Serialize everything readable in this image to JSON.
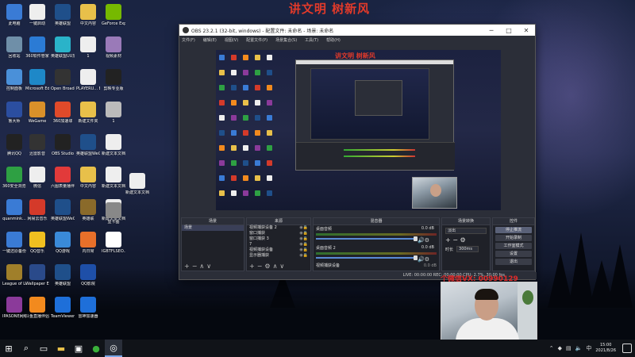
{
  "banner": "讲文明 树新风",
  "desktop": {
    "col1": [
      {
        "label": "此电脑",
        "icon": "pc-icon",
        "color": "#3a7bd5"
      },
      {
        "label": "回收站",
        "icon": "recycle-bin-icon",
        "color": "#6f8fa8"
      },
      {
        "label": "控制面板",
        "icon": "control-panel-icon",
        "color": "#4a90d9"
      },
      {
        "label": "鲁大师",
        "icon": "ludashi-icon",
        "color": "#2b4ea0"
      },
      {
        "label": "腾讯QQ",
        "icon": "qq-icon",
        "color": "#222"
      },
      {
        "label": "360安全浏览器",
        "icon": "360-browser-icon",
        "color": "#2ea043"
      },
      {
        "label": "quanmink...",
        "icon": "quanmin-icon",
        "color": "#3a7bd5"
      },
      {
        "label": "一键还原备份",
        "icon": "restore-icon",
        "color": "#3a7bd5"
      },
      {
        "label": "League of Legends",
        "icon": "lol-icon",
        "color": "#a07f2a"
      },
      {
        "label": "IPASONE网络软件",
        "icon": "ipasone-icon",
        "color": "#8b3a9a"
      }
    ],
    "col2": [
      {
        "label": "一键启动",
        "icon": "file-icon",
        "color": "#eee"
      },
      {
        "label": "360软件管家",
        "icon": "360-manager-icon",
        "color": "#2b7bd5"
      },
      {
        "label": "Microsoft Edge",
        "icon": "edge-icon",
        "color": "#1e88c8"
      },
      {
        "label": "WeGame",
        "icon": "wegame-icon",
        "color": "#d9902a"
      },
      {
        "label": "迅雷影音",
        "icon": "xunlei-icon",
        "color": "#333"
      },
      {
        "label": "微信",
        "icon": "wechat-file-icon",
        "color": "#eee"
      },
      {
        "label": "网易云音乐",
        "icon": "netease-music-icon",
        "color": "#d43a2a"
      },
      {
        "label": "QQ音乐",
        "icon": "qq-music-icon",
        "color": "#f0c020"
      },
      {
        "label": "Wallpaper Engine",
        "icon": "wallpaper-engine-icon",
        "color": "#2a4a8a"
      },
      {
        "label": "斗鱼直播伴侣",
        "icon": "douyu-icon",
        "color": "#f28a1e"
      }
    ],
    "col3": [
      {
        "label": "英雄联盟",
        "icon": "lol-client-icon",
        "color": "#1f4f8a"
      },
      {
        "label": "英雄联盟UU加速器",
        "icon": "uu-icon",
        "color": "#2ab3c9"
      },
      {
        "label": "Open Broadcast...",
        "icon": "obs-icon",
        "color": "#333"
      },
      {
        "label": "360加速球",
        "icon": "360-ball-icon",
        "color": "#e04a2a"
      },
      {
        "label": "OBS Studio",
        "icon": "obs-studio-icon",
        "color": "#222"
      },
      {
        "label": "六图表量播伴侣",
        "icon": "liutu-icon",
        "color": "#e23a3a"
      },
      {
        "label": "英雄联盟WeGame版",
        "icon": "lol-wegame-icon",
        "color": "#1f4f8a"
      },
      {
        "label": "QQ游戏",
        "icon": "qq-game-icon",
        "color": "#3a8ad9"
      },
      {
        "label": "英雄联盟",
        "icon": "lol-client2-icon",
        "color": "#1f4f8a"
      },
      {
        "label": "TeamViewer",
        "icon": "teamviewer-icon",
        "color": "#1e6fd9"
      }
    ],
    "col4": [
      {
        "label": "中文內容",
        "icon": "folder-icon",
        "color": "#e8c04a"
      },
      {
        "label": "1",
        "icon": "file-icon2",
        "color": "#eee"
      },
      {
        "label": "PLAYERU... BATTLEGR...",
        "icon": "pubg-file-icon",
        "color": "#eee"
      },
      {
        "label": "新建文件夹",
        "icon": "folder-new-icon",
        "color": "#e8c04a"
      },
      {
        "label": "英雄联盟WeGame版",
        "icon": "lol-wegame2-icon",
        "color": "#1f4f8a"
      },
      {
        "label": "中文內容",
        "icon": "folder2-icon",
        "color": "#e8c04a"
      },
      {
        "label": "英雄联",
        "icon": "lol3-icon",
        "color": "#8a6a2a"
      },
      {
        "label": "内日常",
        "icon": "daily-icon",
        "color": "#e8702a"
      },
      {
        "label": "QQ影院",
        "icon": "qq-video-icon",
        "color": "#1e4fa8"
      },
      {
        "label": "雷神加速器",
        "icon": "leishen-icon",
        "color": "#1e6fd9"
      }
    ],
    "col5": [
      {
        "label": "GeForce Experience",
        "icon": "nvidia-icon",
        "color": "#76b900"
      },
      {
        "label": "视频素材",
        "icon": "video-file-icon",
        "color": "#9a7ab8"
      },
      {
        "label": "剪映专业版",
        "icon": "jianying-icon",
        "color": "#222"
      },
      {
        "label": "1",
        "icon": "img-file-icon",
        "color": "#bbb"
      },
      {
        "label": "新建文本文档",
        "icon": "txt-icon",
        "color": "#eee"
      },
      {
        "label": "新建文本文档(2)",
        "icon": "txt2-icon",
        "color": "#eee"
      },
      {
        "label": "新建文本文档(3)",
        "icon": "txt3-icon",
        "color": "#eee"
      },
      {
        "label": "IGBTFLSEO...",
        "icon": "igbt-icon",
        "color": "#fff"
      }
    ],
    "extra": [
      {
        "label": "新建文本文档(2)",
        "icon": "txt4-icon",
        "color": "#eee"
      },
      {
        "label": "显卡图",
        "icon": "gpu-img-icon",
        "color": "#888"
      }
    ]
  },
  "obs": {
    "title": "OBS 23.2.1 (32-bit, windows) - 配置文件: 未命名 - 场景: 未命名",
    "menu": [
      "文件(F)",
      "编辑(E)",
      "视图(V)",
      "配置文件(P)",
      "场景集合(S)",
      "工具(T)",
      "帮助(H)"
    ],
    "preview_banner": "讲文明 树新风",
    "docks": {
      "scenes": {
        "title": "场景",
        "items": [
          "场景"
        ]
      },
      "sources": {
        "title": "来源",
        "items": [
          "视频捕获设备 2",
          "窗口捕获",
          "窗口捕获 3",
          "7",
          "视频捕获设备",
          "显示器捕获"
        ]
      },
      "mixer": {
        "title": "混音器",
        "channels": [
          {
            "name": "桌面音频",
            "db": "0.0 dB"
          },
          {
            "name": "桌面音频 2",
            "db": "0.0 dB"
          }
        ],
        "footer": "视频捕获设备",
        "footer_db": "0.0 dB"
      },
      "transitions": {
        "title": "场景转换",
        "type": "淡出",
        "duration_label": "时长",
        "duration": "300ms"
      },
      "controls": {
        "title": "控件",
        "buttons": [
          "停止推流",
          "开始录制",
          "工作室模式",
          "设置",
          "退出"
        ]
      }
    },
    "status": "LIVE: 00:00:00   REC: 00:00:00   CPU: 2.7%, 30.00 fps"
  },
  "overlay": {
    "wechat": "个微信VX: 00990129"
  },
  "taskbar": {
    "clock_time": "15:00",
    "clock_date": "2021/8/26",
    "apps": [
      "windows-icon",
      "search-icon",
      "taskview-icon",
      "file-explorer-icon",
      "store-icon",
      "wechat-app-icon",
      "obs-taskbar-icon"
    ]
  }
}
